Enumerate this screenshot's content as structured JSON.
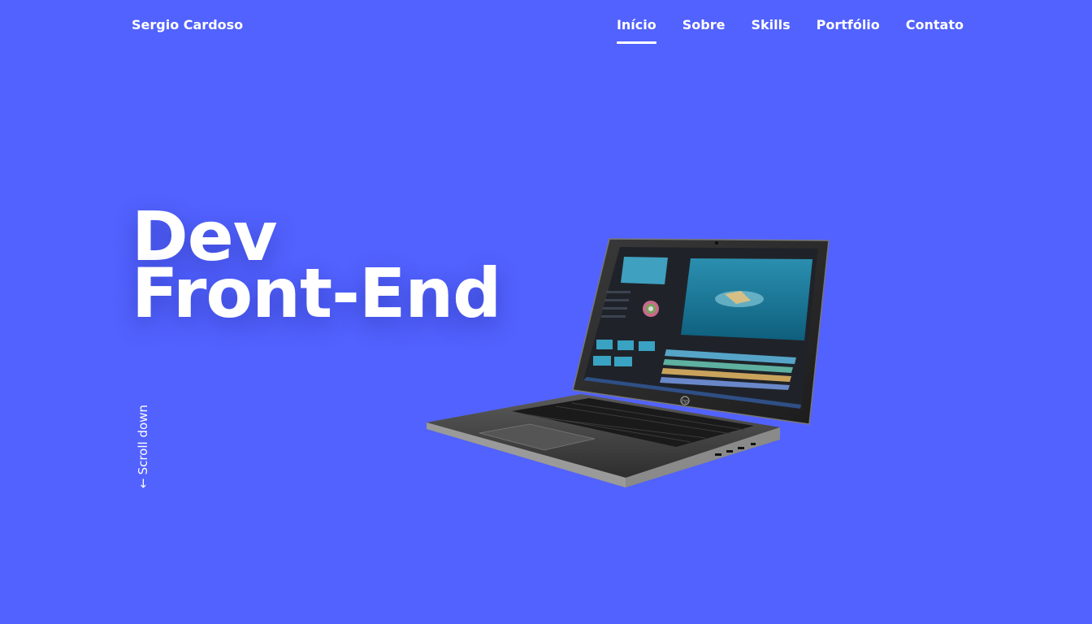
{
  "header": {
    "brand": "Sergio Cardoso",
    "nav": [
      {
        "label": "Início",
        "active": true
      },
      {
        "label": "Sobre",
        "active": false
      },
      {
        "label": "Skills",
        "active": false
      },
      {
        "label": "Portfólio",
        "active": false
      },
      {
        "label": "Contato",
        "active": false
      }
    ]
  },
  "hero": {
    "title_line1": "Dev",
    "title_line2": "Front-End",
    "scroll_label": "Scroll down",
    "scroll_icon": "arrow-down-icon",
    "image_label": "hp"
  },
  "colors": {
    "background": "#5262fe",
    "text": "#ffffff"
  }
}
